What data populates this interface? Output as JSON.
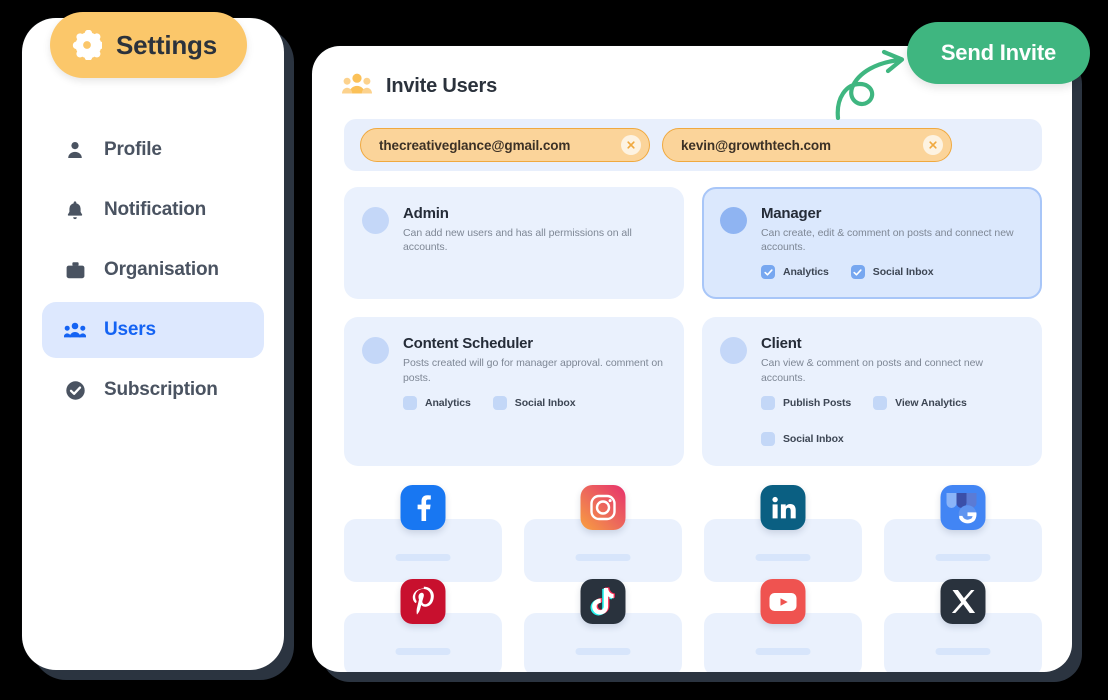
{
  "sidebar": {
    "pill": {
      "label": "Settings",
      "icon": "gear-icon",
      "bg": "#fbc76a"
    },
    "items": [
      {
        "label": "Profile",
        "icon": "person-icon",
        "active": false
      },
      {
        "label": "Notification",
        "icon": "bell-icon",
        "active": false
      },
      {
        "label": "Organisation",
        "icon": "briefcase-icon",
        "active": false
      },
      {
        "label": "Users",
        "icon": "users-icon",
        "active": true
      },
      {
        "label": "Subscription",
        "icon": "check-circle-icon",
        "active": false
      }
    ],
    "active_color": "#1463f3",
    "active_bg": "#dde8fe"
  },
  "main": {
    "title": "Invite Users",
    "title_icon": "users-group-icon",
    "send_invite": {
      "label": "Send Invite",
      "color": "#3fb680"
    },
    "arrow_decoration": "curly-arrow-icon",
    "email_chips": [
      {
        "email": "thecreativeglance@gmail.com",
        "remove_icon": "close-icon"
      },
      {
        "email": "kevin@growthtech.com",
        "remove_icon": "close-icon"
      }
    ],
    "roles": [
      {
        "name": "Admin",
        "description": "Can add new users and has all permissions on all accounts.",
        "selected": false,
        "permissions": []
      },
      {
        "name": "Manager",
        "description": "Can create, edit & comment on posts and connect new accounts.",
        "selected": true,
        "permissions": [
          {
            "label": "Analytics",
            "checked": true
          },
          {
            "label": "Social Inbox",
            "checked": true
          }
        ]
      },
      {
        "name": "Content Scheduler",
        "description": "Posts created will go for manager approval. comment on posts.",
        "selected": false,
        "permissions": [
          {
            "label": "Analytics",
            "checked": false
          },
          {
            "label": "Social Inbox",
            "checked": false
          }
        ]
      },
      {
        "name": "Client",
        "description": "Can view & comment on posts and connect new accounts.",
        "selected": false,
        "permissions": [
          {
            "label": "Publish Posts",
            "checked": false
          },
          {
            "label": "View Analytics",
            "checked": false
          },
          {
            "label": "Social Inbox",
            "checked": false
          }
        ]
      }
    ],
    "social_accounts": [
      {
        "name": "Facebook",
        "icon": "facebook-icon",
        "color": "#1877f2"
      },
      {
        "name": "Instagram",
        "icon": "instagram-icon",
        "color": "#e1306c"
      },
      {
        "name": "LinkedIn",
        "icon": "linkedin-icon",
        "color": "#0a5f82"
      },
      {
        "name": "Google Business",
        "icon": "google-business-icon",
        "color": "#4285f4"
      },
      {
        "name": "Pinterest",
        "icon": "pinterest-icon",
        "color": "#c8102e"
      },
      {
        "name": "TikTok",
        "icon": "tiktok-icon",
        "color": "#29323d"
      },
      {
        "name": "YouTube",
        "icon": "youtube-icon",
        "color": "#ef5350"
      },
      {
        "name": "X",
        "icon": "x-twitter-icon",
        "color": "#29323d"
      }
    ]
  }
}
